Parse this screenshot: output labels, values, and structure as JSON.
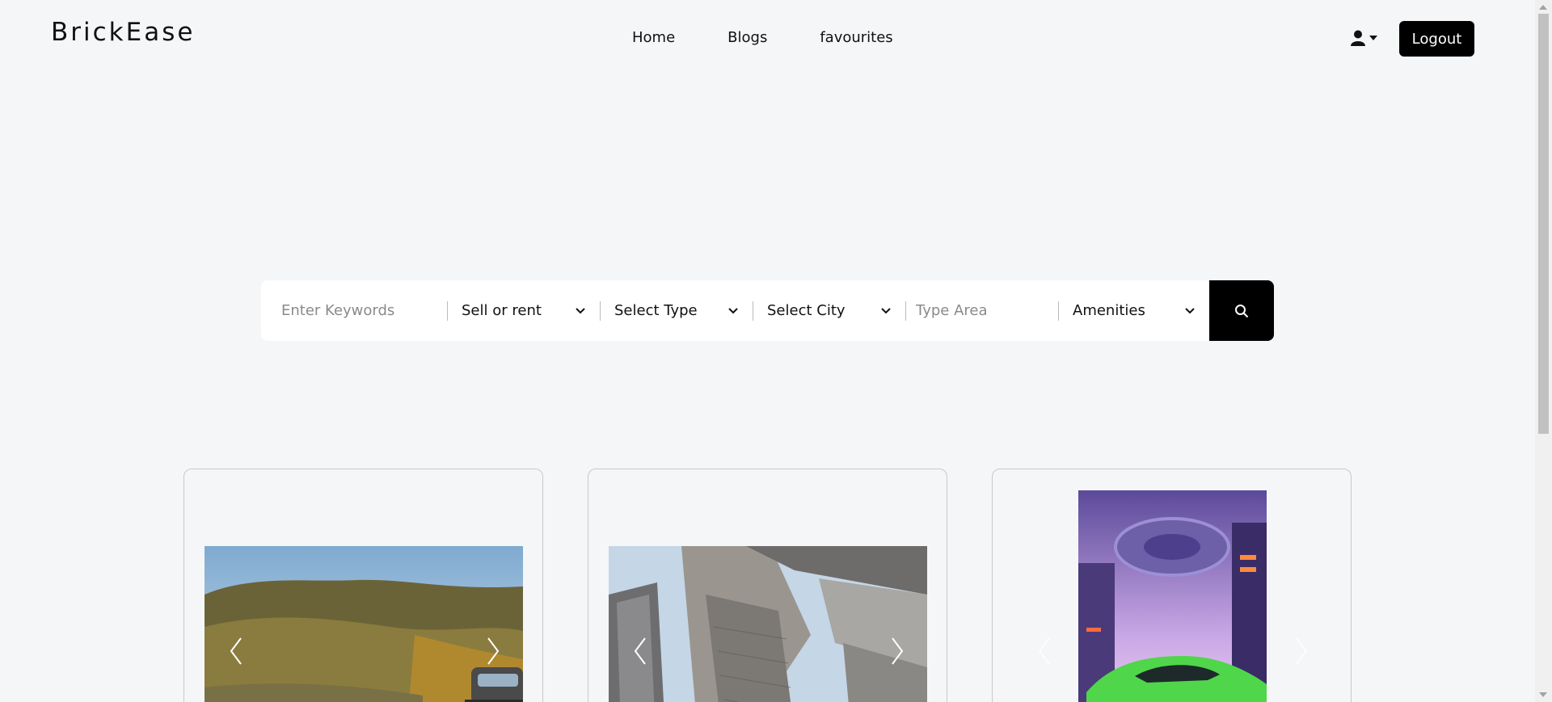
{
  "header": {
    "brand": "BrickEase",
    "nav": [
      "Home",
      "Blogs",
      "favourites"
    ],
    "user_icon": "user-icon",
    "logout_label": "Logout"
  },
  "search": {
    "keywords_placeholder": "Enter Keywords",
    "sell_or_rent": "Sell or rent",
    "type": "Select Type",
    "city": "Select City",
    "area_placeholder": "Type Area",
    "amenities": "Amenities",
    "search_icon": "search-icon"
  },
  "cards": [
    {
      "image": "hillside-road-with-car",
      "prev_icon": "chevron-left-icon",
      "next_icon": "chevron-right-icon"
    },
    {
      "image": "skyscrapers-looking-up",
      "prev_icon": "chevron-left-icon",
      "next_icon": "chevron-right-icon"
    },
    {
      "image": "neon-city-green-sports-car",
      "prev_icon": "chevron-left-icon",
      "next_icon": "chevron-right-icon"
    }
  ],
  "colors": {
    "background": "#f4f6f8",
    "primary": "#000000",
    "text": "#111111"
  }
}
